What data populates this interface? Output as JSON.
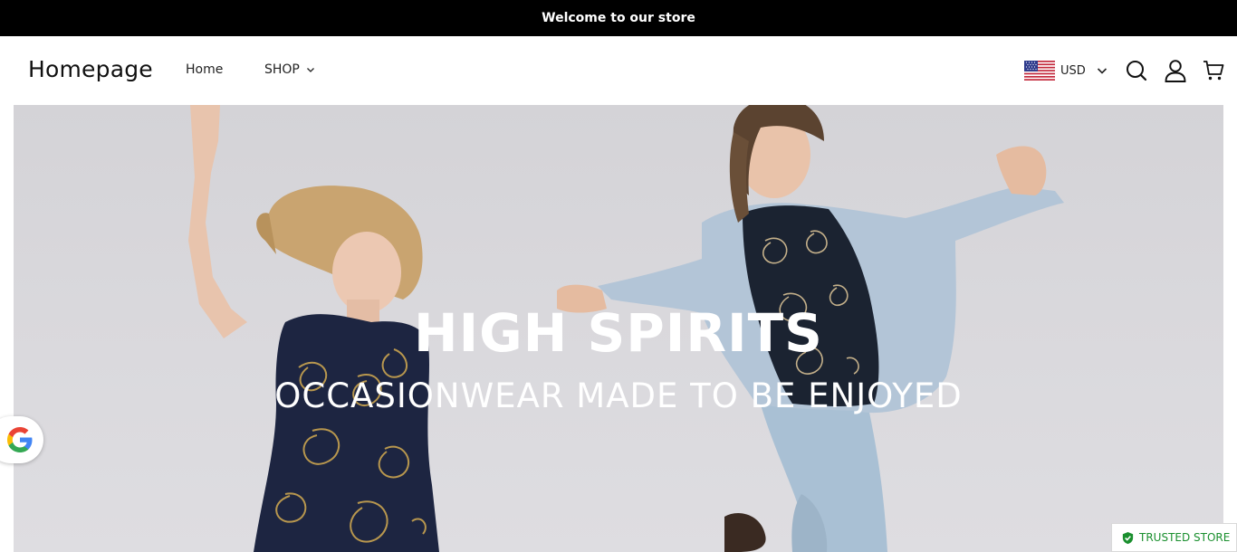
{
  "announcement": {
    "text": "Welcome to our store"
  },
  "header": {
    "logo": "Homepage",
    "nav": {
      "home": "Home",
      "shop": "SHOP"
    },
    "currency": {
      "code": "USD",
      "flag": "us-flag-icon"
    },
    "icons": [
      "search-icon",
      "account-icon",
      "cart-icon"
    ]
  },
  "hero": {
    "title": "HIGH SPIRITS",
    "subtitle": "OCCASIONWEAR MADE TO BE ENJOYED"
  },
  "badges": {
    "google": "google-icon",
    "trusted": "TRUSTED STORE"
  },
  "colors": {
    "announcement_bg": "#000000",
    "trusted_green": "#1a8f2e",
    "hero_bg": "#d8d7db"
  }
}
